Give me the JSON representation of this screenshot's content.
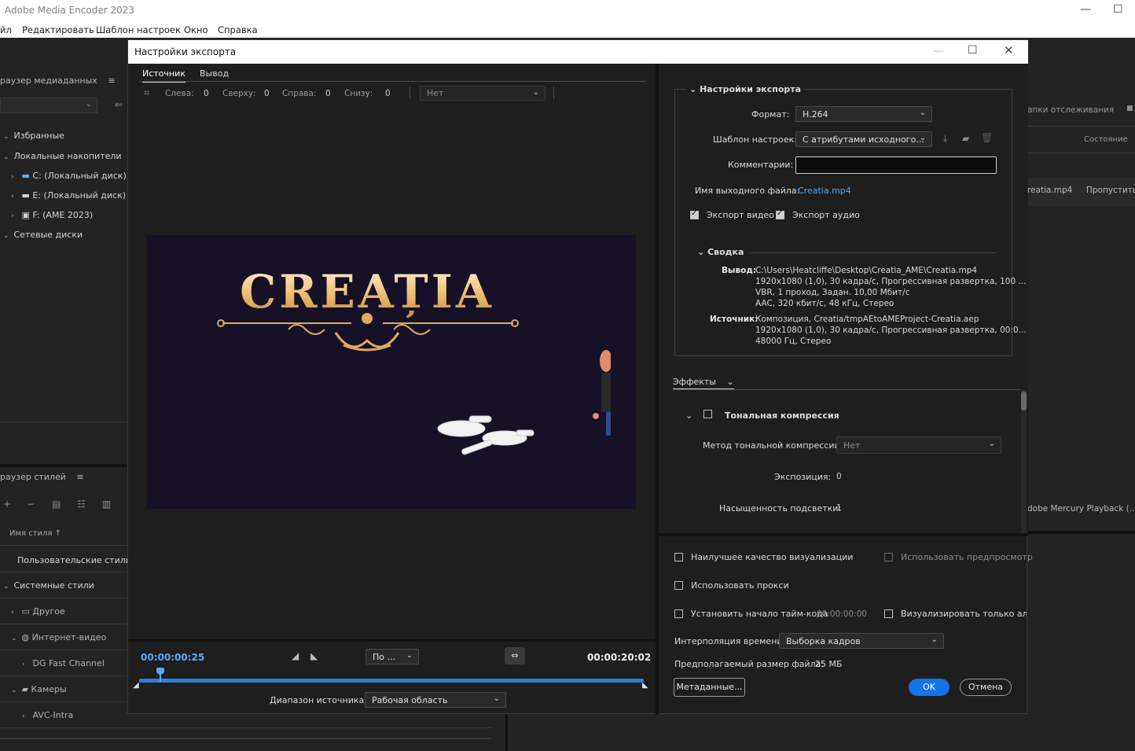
{
  "app": {
    "title": "Adobe Media Encoder 2023",
    "menu": [
      "йл",
      "Редактировать",
      "Шаблон настроек",
      "Окно",
      "Справка"
    ]
  },
  "left_panel": {
    "media_browser_title": "раузер медиаданных",
    "favorites": "Избранные",
    "local_drives": "Локальные накопители",
    "drives": [
      "C: (Локальный диск)",
      "E: (Локальный диск)",
      "F: (AME 2023)"
    ],
    "network_drives": "Сетевые диски",
    "style_browser_title": "раузер стилей",
    "style_name_header": "Имя стиля",
    "user_styles": "Пользовательские стили и",
    "system_styles": "Системные стили",
    "style_items": [
      "Другое",
      "Интернет-видео",
      "DG Fast Channel",
      "Камеры",
      "AVC-Intra"
    ]
  },
  "right_bg": {
    "watch_tab": "апки отслеживания",
    "status_header": "Состояние",
    "queue_file": "reatia.mp4",
    "queue_status": "Пропустить",
    "renderer": "dobe Mercury Playback (..."
  },
  "dialog": {
    "title": "Настройки экспорта",
    "tabs": [
      "Источник",
      "Вывод"
    ],
    "crop": {
      "left_label": "Слева:",
      "left_val": "0",
      "top_label": "Сверху:",
      "top_val": "0",
      "right_label": "Справа:",
      "right_val": "0",
      "bottom_label": "Снизу:",
      "bottom_val": "0",
      "aspect": "Нет"
    },
    "preview_title": "CREAȚIA",
    "timeline": {
      "current": "00:00:00:25",
      "duration": "00:00:20:02",
      "fit": "По ...",
      "position": 0.042,
      "source_range_label": "Диапазон источника:",
      "source_range": "Рабочая область"
    },
    "export_settings": {
      "header": "Настройки экспорта",
      "format_label": "Формат:",
      "format": "H.264",
      "preset_label": "Шаблон настроек:",
      "preset": "С атрибутами исходного...",
      "comments_label": "Комментарии:",
      "comments": "",
      "output_label": "Имя выходного файла:",
      "output_name": "Creatia.mp4",
      "export_video": "Экспорт видео",
      "export_audio": "Экспорт аудио"
    },
    "summary": {
      "header": "Сводка",
      "output_key": "Вывод:",
      "output_lines": [
        "C:\\Users\\Heatcliffe\\Desktop\\Creatia_AME\\Creatia.mp4",
        "1920x1080 (1,0), 30 кадра/с, Прогрессивная развертка, 100 ...",
        "VBR, 1 проход, Задан. 10,00 Мбит/с",
        "AAC, 320 кбит/с, 48 кГц, Стерео"
      ],
      "source_key": "Источник:",
      "source_lines": [
        "Композиция, Creatia/tmpAEtoAMEProject-Creatia.aep",
        "1920x1080 (1,0), 30 кадра/с, Прогрессивная развертка, 00:0...",
        "48000 Гц, Стерео"
      ]
    },
    "effects": {
      "tab": "Эффекты",
      "tone_mapping": "Тональная компрессия",
      "method_label": "Метод тональной компрессии:",
      "method": "Нет",
      "exposure_label": "Экспозиция:",
      "exposure": "0",
      "highlight_label": "Насыщенность подсветки:",
      "highlight": "1"
    },
    "bottom": {
      "max_quality": "Наилучшее качество визуализации",
      "use_previews": "Использовать предпросмотр",
      "use_proxies": "Использовать прокси",
      "set_timecode": "Установить начало тайм-кода",
      "timecode": "00:00:00:00",
      "alpha_only": "Визуализировать только альфа",
      "interp_label": "Интерполяция времени:",
      "interp": "Выборка кадров",
      "filesize_label": "Предполагаемый размер файла:",
      "filesize": "25 МБ",
      "metadata_btn": "Метаданные...",
      "ok_btn": "OK",
      "cancel_btn": "Отмена"
    }
  }
}
